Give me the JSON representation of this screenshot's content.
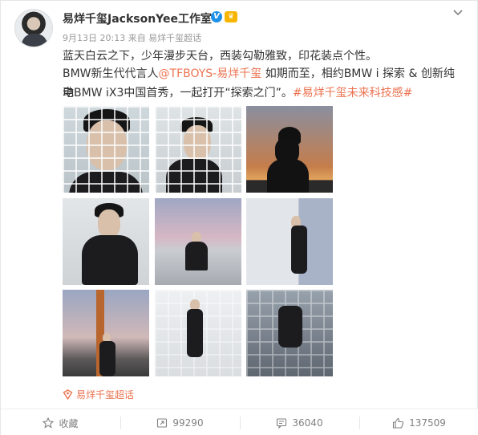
{
  "post": {
    "author": "易烊千玺JacksonYee工作室",
    "verified_badge": "V",
    "vip_badge": "♛",
    "meta": "9月13日 20:13 来自 易烊千玺超话",
    "line1": "蓝天白云之下，少年漫步天台，西装勾勒雅致，印花装点个性。",
    "line2_prefix": "BMW新生代代言人",
    "line2_mention": "@TFBOYS-易烊千玺",
    "line2_suffix": " 如期而至，相约BMW i 探索 & 创新纯电",
    "line3_text": "动BMW iX3中国首秀，一起打开“探索之门”。",
    "line3_hashtag": "#易烊千玺未来科技感#",
    "topic_label": "易烊千玺超话"
  },
  "actions": {
    "favorite": "收藏",
    "repost": "99290",
    "comment": "36040",
    "like": "137509"
  },
  "icons": [
    "chevron-down-icon",
    "star-icon",
    "repost-icon",
    "comment-icon",
    "like-icon",
    "topic-icon"
  ],
  "colors": {
    "link": "#eb7350",
    "verified": "#1e90e8",
    "muted": "#999999"
  }
}
